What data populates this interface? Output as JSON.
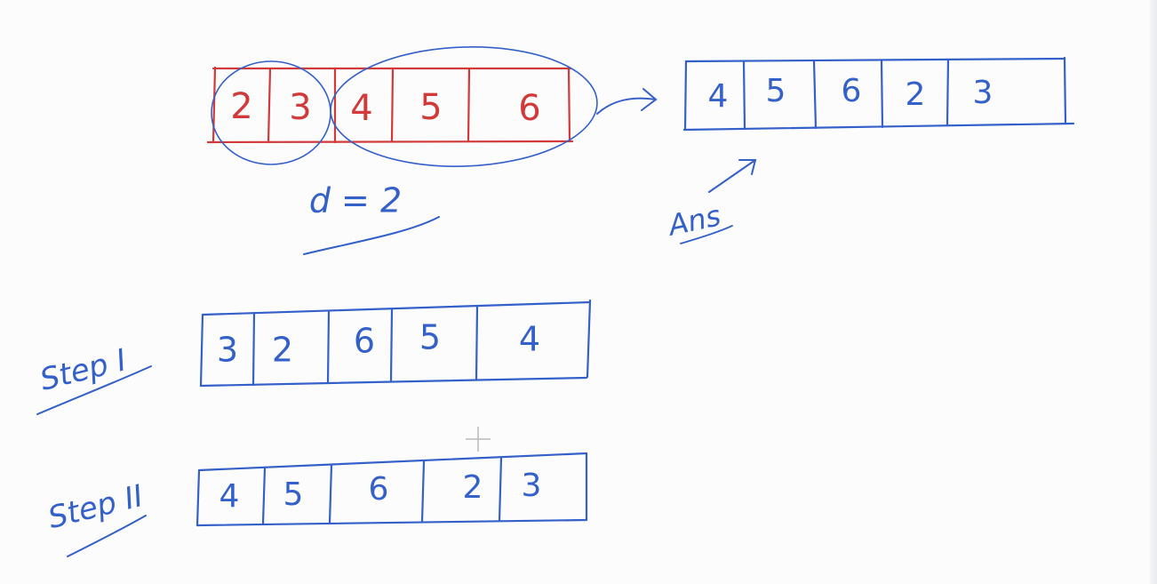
{
  "colors": {
    "blue": "#3460c9",
    "red": "#d23a3a",
    "cursor": "#b9b9b9"
  },
  "original_array": {
    "values": [
      "2",
      "3",
      "4",
      "5",
      "6"
    ]
  },
  "d_label": "d = 2",
  "ans_label": "Ans",
  "answer_array": {
    "values": [
      "4",
      "5",
      "6",
      "2",
      "3"
    ]
  },
  "step1": {
    "label": "Step I",
    "values": [
      "3",
      "2",
      "6",
      "5",
      "4"
    ]
  },
  "step2": {
    "label": "Step II",
    "values": [
      "4",
      "5",
      "6",
      "2",
      "3"
    ]
  }
}
